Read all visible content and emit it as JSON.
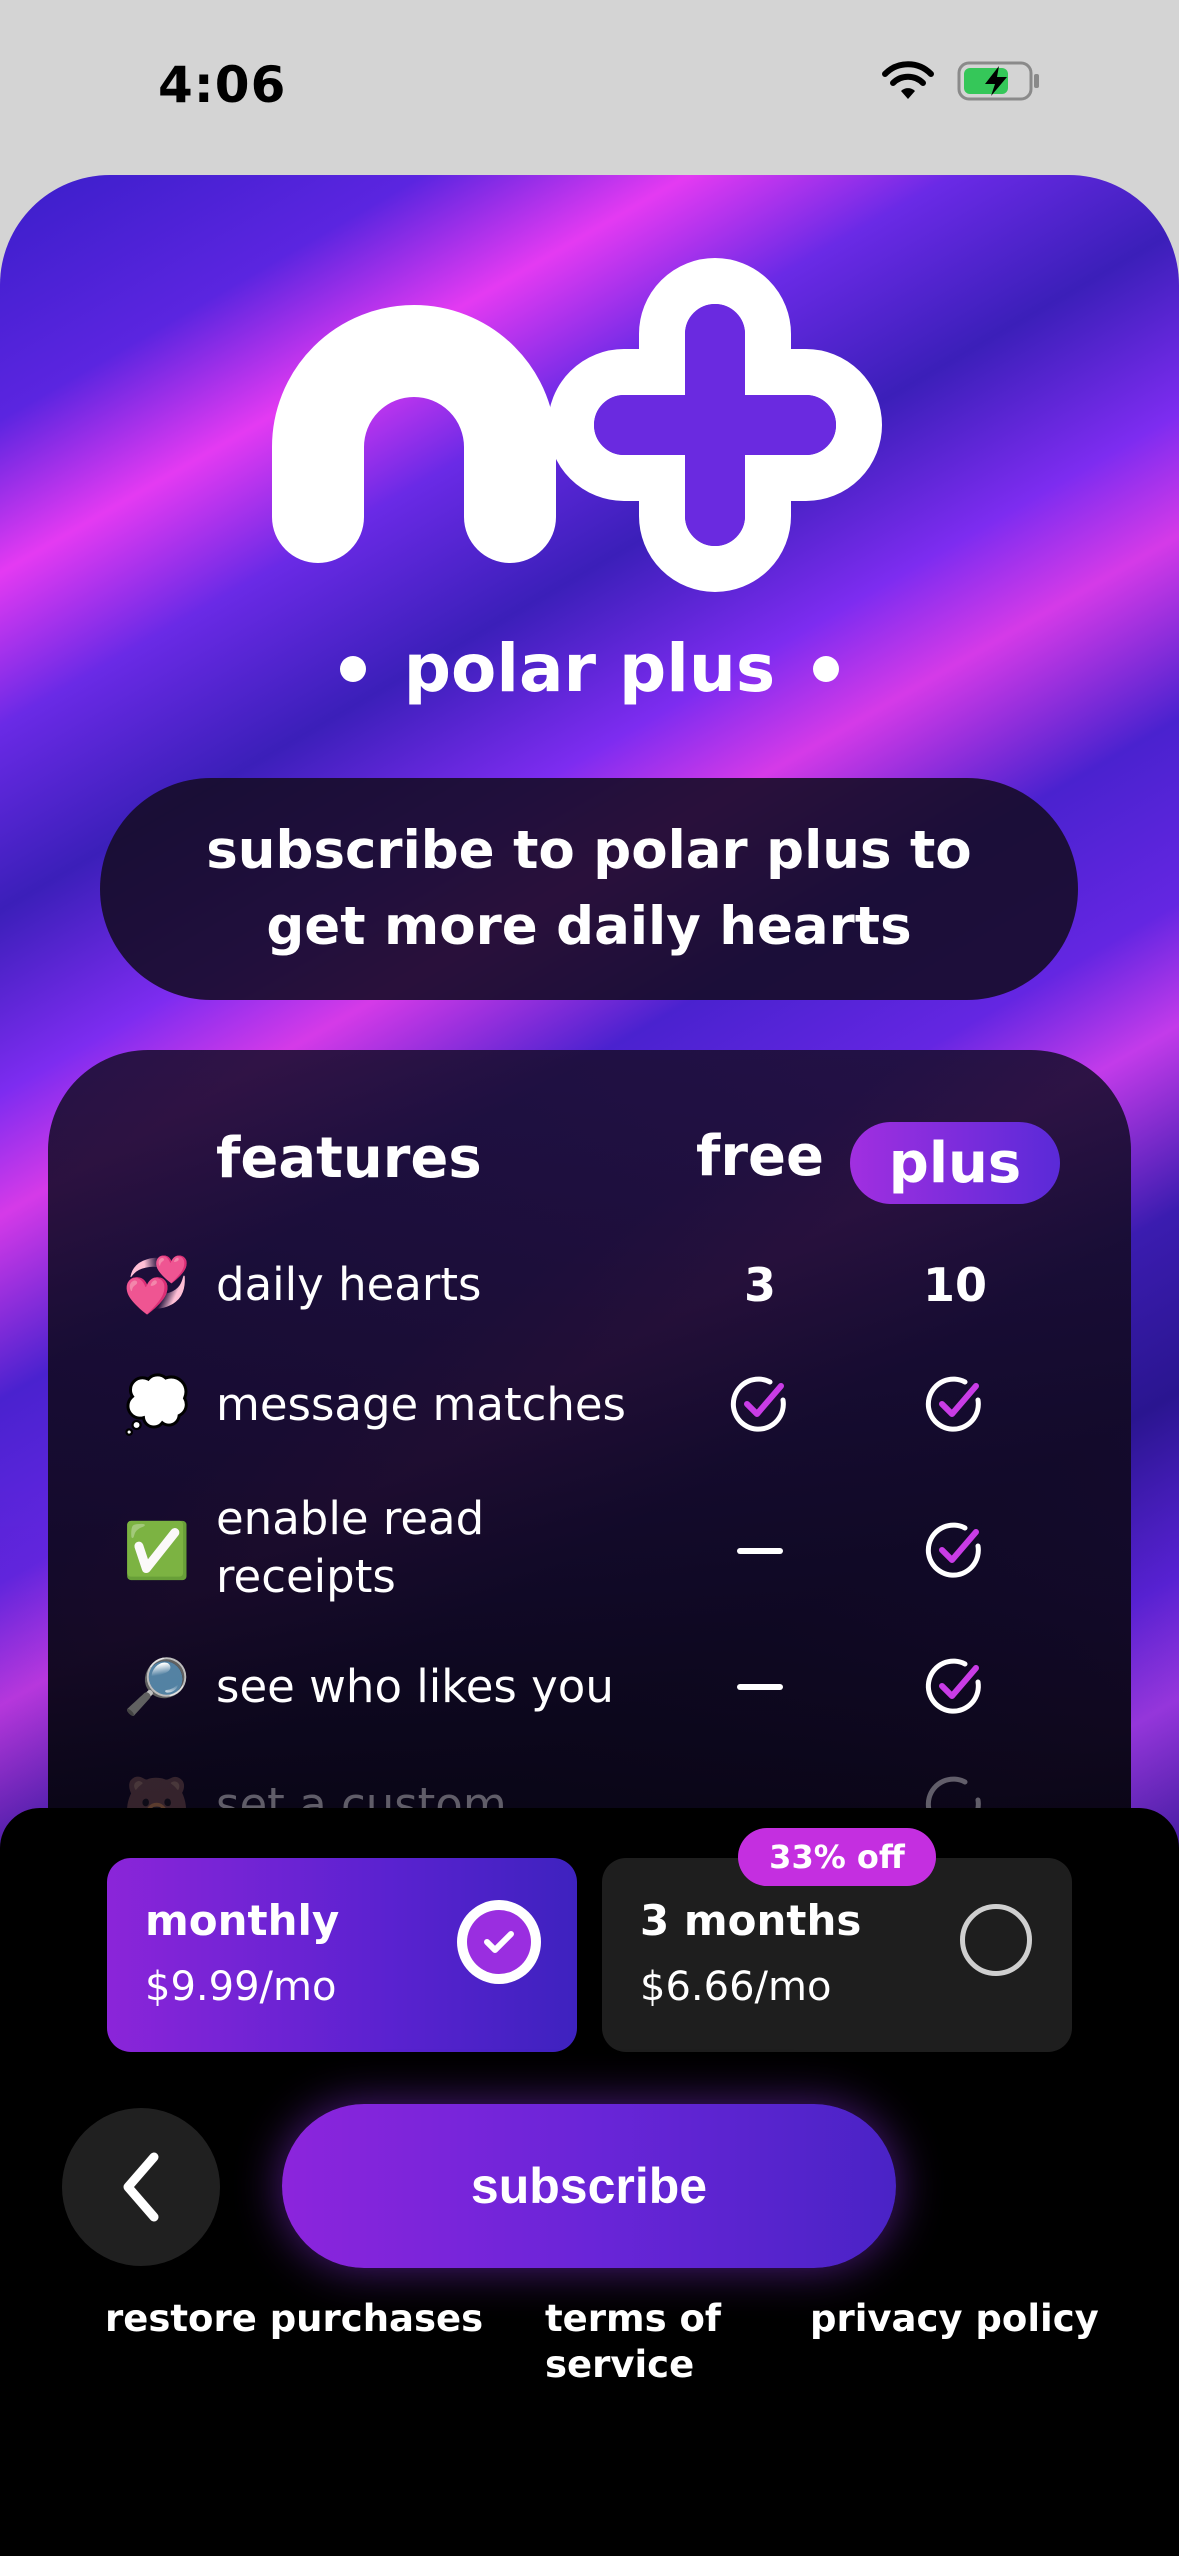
{
  "status_bar": {
    "time": "4:06",
    "icons": [
      "wifi-icon",
      "battery-charging-icon"
    ]
  },
  "brand": {
    "name": "polar plus"
  },
  "headline": "subscribe to polar plus to get more daily hearts",
  "features_table": {
    "headers": {
      "feature": "features",
      "free": "free",
      "plus": "plus"
    },
    "rows": [
      {
        "icon": "💞",
        "label": "daily hearts",
        "free": "3",
        "plus": "10"
      },
      {
        "icon": "💭",
        "label": "message matches",
        "free": "check",
        "plus": "check"
      },
      {
        "icon": "✅",
        "label": "enable read receipts",
        "free": "dash",
        "plus": "check"
      },
      {
        "icon": "🔎",
        "label": "see who likes you",
        "free": "dash",
        "plus": "check"
      },
      {
        "icon": "🐻",
        "label": "set a custom",
        "free": "",
        "plus": "check"
      }
    ]
  },
  "plans": [
    {
      "title": "monthly",
      "price": "$9.99/mo",
      "selected": true
    },
    {
      "title": "3 months",
      "price": "$6.66/mo",
      "selected": false,
      "badge": "33% off"
    }
  ],
  "actions": {
    "subscribe": "subscribe"
  },
  "footer_links": {
    "restore": "restore purchases",
    "terms": "terms of service",
    "privacy": "privacy policy"
  },
  "colors": {
    "accent": "#8c25dc",
    "accent_secondary": "#4a23c6",
    "badge": "#c42fe0",
    "sheet_bg": "#000000"
  }
}
